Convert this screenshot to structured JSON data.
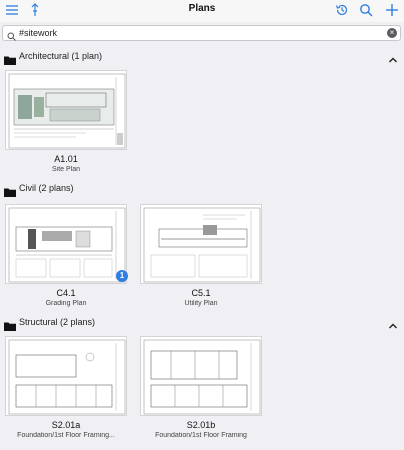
{
  "header": {
    "title": "Plans",
    "icons": [
      "menu-icon",
      "pin-icon",
      "history-icon",
      "search-icon",
      "add-icon"
    ]
  },
  "search": {
    "value": "#sitework"
  },
  "sections": [
    {
      "label": "Architectural (1 plan)",
      "plans": [
        {
          "code": "A1.01",
          "title": "Site Plan"
        }
      ]
    },
    {
      "label": "Civil (2 plans)",
      "plans": [
        {
          "code": "C4.1",
          "title": "Grading Plan",
          "badge": "1"
        },
        {
          "code": "C5.1",
          "title": "Utility Plan"
        }
      ]
    },
    {
      "label": "Structural (2 plans)",
      "plans": [
        {
          "code": "S2.01a",
          "title": "Foundation/1st Floor Framing..."
        },
        {
          "code": "S2.01b",
          "title": "Foundation/1st Floor Framing"
        }
      ]
    }
  ],
  "colors": {
    "accent": "#2f7de1",
    "background": "#efeff4"
  }
}
